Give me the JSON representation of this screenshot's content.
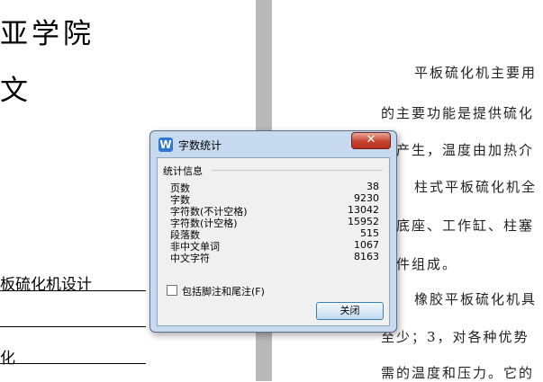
{
  "document": {
    "heading_line1": "亚学院",
    "heading_line2": "文",
    "field1": "板硫化机设计",
    "field3": "化",
    "paragraphs": [
      "平板硫化机主要用",
      "的主要功能是提供硫化",
      "产生，温度由加热介",
      "柱式平板硫化机全",
      "底座、工作缸、柱塞",
      "件组成。",
      "橡胶平板硫化机具",
      "至少；3，对各种优势",
      "需的温度和压力。它的"
    ]
  },
  "dialog": {
    "title": "字数统计",
    "app_icon_letter": "W",
    "close_glyph": "✕",
    "group_label": "统计信息",
    "stats": [
      {
        "label": "页数",
        "value": "38"
      },
      {
        "label": "字数",
        "value": "9230"
      },
      {
        "label": "字符数(不计空格)",
        "value": "13042"
      },
      {
        "label": "字符数(计空格)",
        "value": "15952"
      },
      {
        "label": "段落数",
        "value": "515"
      },
      {
        "label": "非中文单词",
        "value": "1067"
      },
      {
        "label": "中文字符",
        "value": "8163"
      }
    ],
    "checkbox_label": "包括脚注和尾注(F)",
    "checkbox_checked": false,
    "close_button_label": "关闭"
  }
}
